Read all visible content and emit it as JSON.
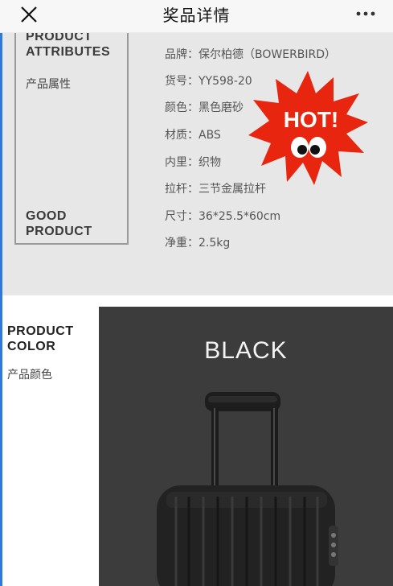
{
  "topbar": {
    "title": "奖品详情",
    "close_icon": "close-icon",
    "more_icon": "more-icon"
  },
  "attributes": {
    "heading_en": "PRODUCT\nATTRIBUTES",
    "heading_cn": "产品属性",
    "footer_en": "GOOD\nPRODUCT",
    "specs": [
      "品牌：保尔柏德（BOWERBIRD）",
      "货号：YY598-20",
      "颜色：黑色磨砂",
      "材质：ABS",
      "内里：织物",
      "拉杆：三节金属拉杆",
      "尺寸：36*25.5*60cm",
      "净重：2.5kg"
    ]
  },
  "hot_badge": {
    "text": "HOT!",
    "color": "#e8250f"
  },
  "color_section": {
    "heading_en": "PRODUCT\nCOLOR",
    "heading_cn": "产品颜色",
    "variant_label": "BLACK"
  },
  "colors": {
    "accent_left_bar": "#2d7bd8",
    "attributes_bg": "#e7e7e7",
    "photo_bg": "#3c3c3c"
  }
}
